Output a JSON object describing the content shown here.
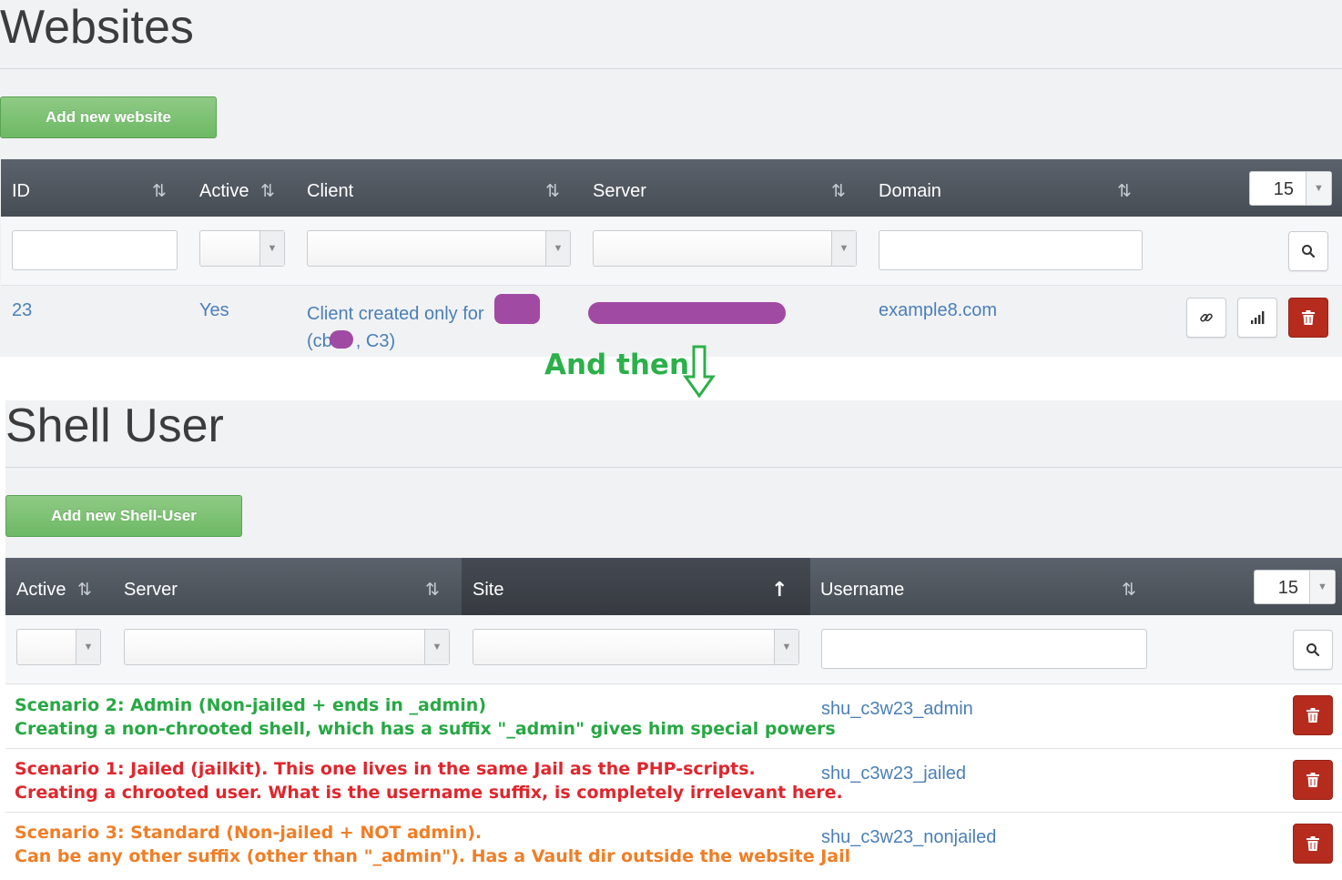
{
  "websites": {
    "title": "Websites",
    "add_button": "Add new website",
    "columns": [
      "ID",
      "Active",
      "Client",
      "Server",
      "Domain"
    ],
    "page_size": "15",
    "rows": [
      {
        "id": "23",
        "active": "Yes",
        "client_line1": "Client created only for",
        "client_line2_a": "(cb",
        "client_line2_b": ", C3)",
        "domain": "example8.com"
      }
    ]
  },
  "annotation": {
    "text": "And then",
    "arrow": "down-arrow-icon",
    "color": "#2bb04a"
  },
  "shell_users": {
    "title": "Shell User",
    "add_button": "Add new Shell-User",
    "columns": [
      "Active",
      "Server",
      "Site",
      "Username"
    ],
    "sorted_column": "Site",
    "page_size": "15",
    "rows": [
      {
        "note_line1": "Scenario 2: Admin (Non-jailed + ends in _admin)",
        "note_line2": "Creating a non-chrooted shell, which has a suffix \"_admin\" gives him special powers",
        "note_color": "#27a844",
        "username": "shu_c3w23_admin"
      },
      {
        "note_line1": "Scenario 1: Jailed (jailkit). This one lives in the same Jail as the PHP-scripts.",
        "note_line2": "Creating a chrooted user. What is the username suffix, is completely irrelevant here.",
        "note_color": "#e0262d",
        "username": "shu_c3w23_jailed"
      },
      {
        "note_line1": "Scenario 3: Standard (Non-jailed + NOT admin).",
        "note_line2": "Can be any other suffix (other than \"_admin\"). Has a Vault dir outside the website Jail",
        "note_color": "#f07e26",
        "username": "shu_c3w23_nonjailed"
      }
    ]
  },
  "colors": {
    "header_bg": "#4e555d",
    "button_green": "#7cc273",
    "delete_red": "#b52b1e",
    "link_blue": "#4a7fb8",
    "redaction": "#a04aa3"
  }
}
